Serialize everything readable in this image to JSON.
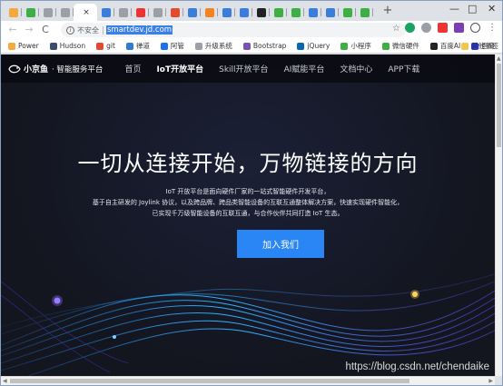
{
  "browser": {
    "tabs": [
      {
        "color": "#f3a93c"
      },
      {
        "color": "#3cb043"
      },
      {
        "color": "#9aa0a6"
      },
      {
        "color": "#9aa0a6"
      },
      {
        "color": "#3b7ddd"
      },
      {
        "color": "#9aa0a6"
      },
      {
        "color": "#e33"
      },
      {
        "color": "#9aa0a6"
      },
      {
        "color": "#e34a2d"
      },
      {
        "color": "#3b7ddd"
      },
      {
        "color": "#f58220"
      },
      {
        "color": "#3b7ddd"
      },
      {
        "color": "#3b7ddd"
      },
      {
        "color": "#222"
      },
      {
        "color": "#3cb043"
      },
      {
        "color": "#3cb043"
      },
      {
        "color": "#3b7ddd"
      },
      {
        "color": "#3b7ddd"
      },
      {
        "color": "#3cb043"
      },
      {
        "color": "#3cb043"
      }
    ],
    "active_tab_close": "×",
    "new_tab": "+",
    "window_controls": {
      "minimize": "—",
      "maximize": "□",
      "close": "✕"
    }
  },
  "toolbar": {
    "back": "←",
    "forward": "→",
    "reload": "C",
    "security_label": "不安全",
    "url": "smartdev.jd.com",
    "star": "☆",
    "menu": "⋮"
  },
  "bookmarks": [
    {
      "label": "Power",
      "color": "#f3a93c"
    },
    {
      "label": "Hudson",
      "color": "#3b4b6b"
    },
    {
      "label": "git",
      "color": "#e34a2d"
    },
    {
      "label": "禅道",
      "color": "#2e7bd6"
    },
    {
      "label": "阿管",
      "color": "#1a73e8"
    },
    {
      "label": "升级系统",
      "color": "#9aa0a6"
    },
    {
      "label": "Bootstrap",
      "color": "#7952b3"
    },
    {
      "label": "jQuery",
      "color": "#0769ad"
    },
    {
      "label": "小程序",
      "color": "#3cb043"
    },
    {
      "label": "微信硬件",
      "color": "#3cb043"
    },
    {
      "label": "百度AI",
      "color": "#222"
    },
    {
      "label": "百度",
      "color": "#2932e1"
    }
  ],
  "bookmarks_more": "»",
  "bookmarks_other": "其他书签",
  "site": {
    "logo_name": "小京鱼",
    "logo_sub": "智能服务平台",
    "nav": [
      {
        "label": "首页",
        "active": false
      },
      {
        "label": "IoT开放平台",
        "active": true
      },
      {
        "label": "Skill开放平台",
        "active": false
      },
      {
        "label": "AI赋能平台",
        "active": false
      },
      {
        "label": "文档中心",
        "active": false
      },
      {
        "label": "APP下载",
        "active": false
      }
    ],
    "hero_title": "一切从连接开始，万物链接的方向",
    "hero_lines": [
      "IoT 开放平台是面向硬件厂家的一站式智能硬件开发平台，",
      "基于自主研发的 Joylink 协议，以及跨品牌、跨品类智能设备的互联互通整体解决方案，快速实现硬件智能化，",
      "已实现千万级智能设备的互联互通，与合作伙伴共同打造 IoT 生态。"
    ],
    "cta": "加入我们"
  },
  "watermark": "https://blog.csdn.net/chendaike",
  "colors": {
    "accent": "#2a85f5",
    "page_bg": "#13151f",
    "url_highlight": "#3b80e8"
  }
}
